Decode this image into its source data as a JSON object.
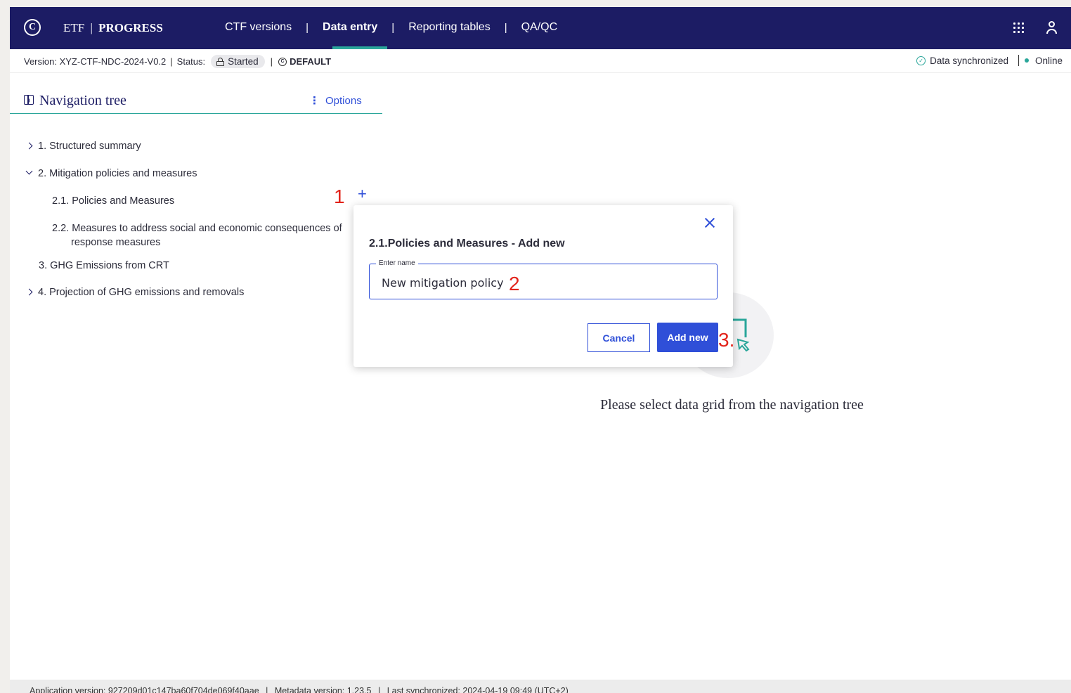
{
  "header": {
    "brand_etf": "ETF",
    "brand_sep": "|",
    "brand_progress": "PROGRESS",
    "nav": {
      "ctf_versions": "CTF versions",
      "data_entry": "Data entry",
      "reporting_tables": "Reporting tables",
      "qa_qc": "QA/QC",
      "separator": "|"
    },
    "icons": [
      "un-logo-icon",
      "apps-grid-icon",
      "user-icon"
    ]
  },
  "status_bar": {
    "version_label": "Version: XYZ-CTF-NDC-2024-V0.2",
    "status_label": "Status:",
    "status_value": "Started",
    "default_label": "DEFAULT",
    "sync_label": "Data synchronized",
    "online_label": "Online",
    "separator": "|"
  },
  "navigation_panel": {
    "title": "Navigation tree",
    "options_label": "Options",
    "items": [
      {
        "label": "1. Structured summary",
        "expanded": false
      },
      {
        "label": "2. Mitigation policies and measures",
        "expanded": true
      },
      {
        "label": "2.1. Policies and Measures"
      },
      {
        "label": "2.2. Measures to address social and economic consequences of"
      },
      {
        "label": "response measures"
      },
      {
        "label": "3. GHG Emissions from CRT"
      },
      {
        "label": "4. Projection of GHG emissions and removals",
        "expanded": false
      }
    ],
    "add_icon_label": "+"
  },
  "annotations": {
    "step1": "1",
    "step2": "2",
    "step3": "3."
  },
  "dialog": {
    "title": "2.1.Policies and Measures - Add new",
    "field_label": "Enter name",
    "field_value": "New mitigation policy",
    "cancel_label": "Cancel",
    "add_label": "Add new"
  },
  "main": {
    "empty_message": "Please select data grid from the navigation tree"
  },
  "footer": {
    "app_version": "Application version: 927209d01c147ba60f704de069f40aae",
    "metadata_version": "Metadata version: 1.23.5",
    "last_sync": "Last synchronized: 2024-04-19 09:49 (UTC+2)",
    "separator": "|"
  },
  "colors": {
    "header_bg": "#1c1c64",
    "accent_teal": "#2aa69a",
    "primary_blue": "#2f4fd8",
    "annotation_red": "#e2231a"
  }
}
